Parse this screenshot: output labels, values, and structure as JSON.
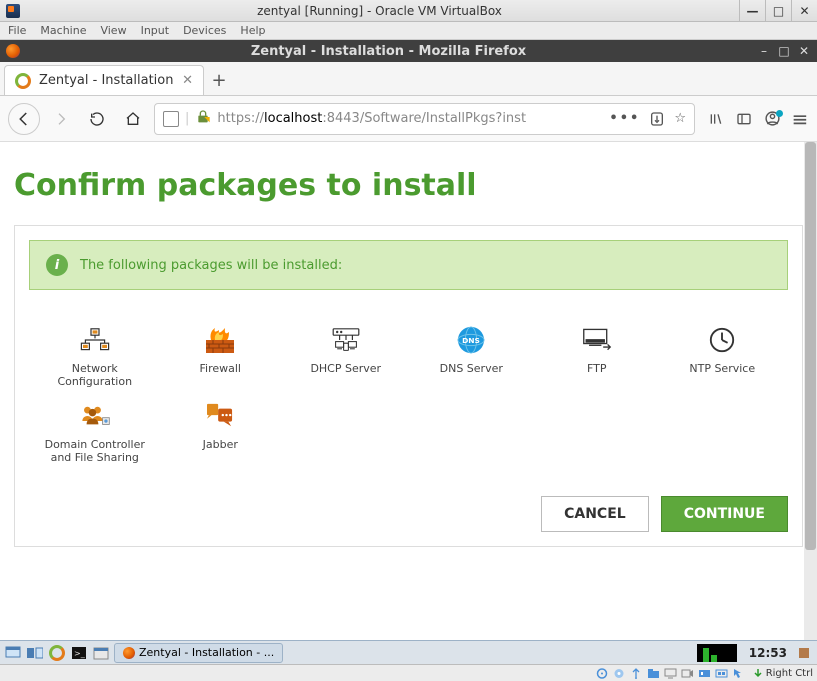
{
  "vbox": {
    "title": "zentyal [Running] - Oracle VM VirtualBox",
    "menu": [
      "File",
      "Machine",
      "View",
      "Input",
      "Devices",
      "Help"
    ],
    "right_ctrl": "Right Ctrl"
  },
  "firefox": {
    "window_title": "Zentyal - Installation - Mozilla Firefox",
    "tab_title": "Zentyal - Installation",
    "url_proto": "https://",
    "url_host": "localhost",
    "url_port": ":8443",
    "url_path": "/Software/InstallPkgs?inst"
  },
  "page": {
    "title": "Confirm packages to install",
    "banner_text": "The following packages will be installed:",
    "packages": [
      {
        "label": "Network Configuration"
      },
      {
        "label": "Firewall"
      },
      {
        "label": "DHCP Server"
      },
      {
        "label": "DNS Server"
      },
      {
        "label": "FTP"
      },
      {
        "label": "NTP Service"
      },
      {
        "label": "Domain Controller and File Sharing"
      },
      {
        "label": "Jabber"
      }
    ],
    "cancel": "CANCEL",
    "continue": "CONTINUE"
  },
  "taskbar": {
    "task_label": "Zentyal - Installation - ...",
    "time": "12:53"
  }
}
